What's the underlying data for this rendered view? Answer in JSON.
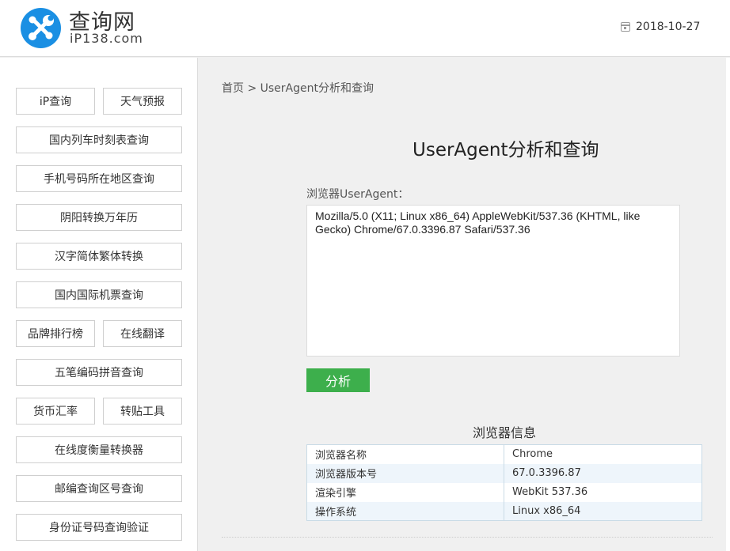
{
  "header": {
    "logo_name": "查询网",
    "logo_domain": "iP138.com",
    "date": "2018-10-27"
  },
  "sidebar": {
    "items": [
      {
        "label": "iP查询"
      },
      {
        "label": "天气预报"
      },
      {
        "label": "国内列车时刻表查询"
      },
      {
        "label": "手机号码所在地区查询"
      },
      {
        "label": "阴阳转换万年历"
      },
      {
        "label": "汉字简体繁体转换"
      },
      {
        "label": "国内国际机票查询"
      },
      {
        "label": "品牌排行榜"
      },
      {
        "label": "在线翻译"
      },
      {
        "label": "五笔编码拼音查询"
      },
      {
        "label": "货币汇率"
      },
      {
        "label": "转贴工具"
      },
      {
        "label": "在线度衡量转换器"
      },
      {
        "label": "邮编查询区号查询"
      },
      {
        "label": "身份证号码查询验证"
      }
    ]
  },
  "breadcrumb": {
    "home": "首页",
    "separator": " > ",
    "current": "UserAgent分析和查询"
  },
  "main": {
    "title": "UserAgent分析和查询",
    "field_label": "浏览器UserAgent：",
    "user_agent": "Mozilla/5.0 (X11; Linux x86_64) AppleWebKit/537.36 (KHTML, like Gecko) Chrome/67.0.3396.87 Safari/537.36",
    "analyze_label": "分析",
    "info_title": "浏览器信息",
    "info_rows": [
      {
        "key": "浏览器名称",
        "value": "Chrome"
      },
      {
        "key": "浏览器版本号",
        "value": "67.0.3396.87"
      },
      {
        "key": "渲染引擎",
        "value": "WebKit 537.36"
      },
      {
        "key": "操作系统",
        "value": "Linux x86_64"
      }
    ]
  },
  "colors": {
    "brand_blue": "#1a8fe3",
    "button_green": "#3daf4c",
    "table_border": "#c9dbe6"
  }
}
